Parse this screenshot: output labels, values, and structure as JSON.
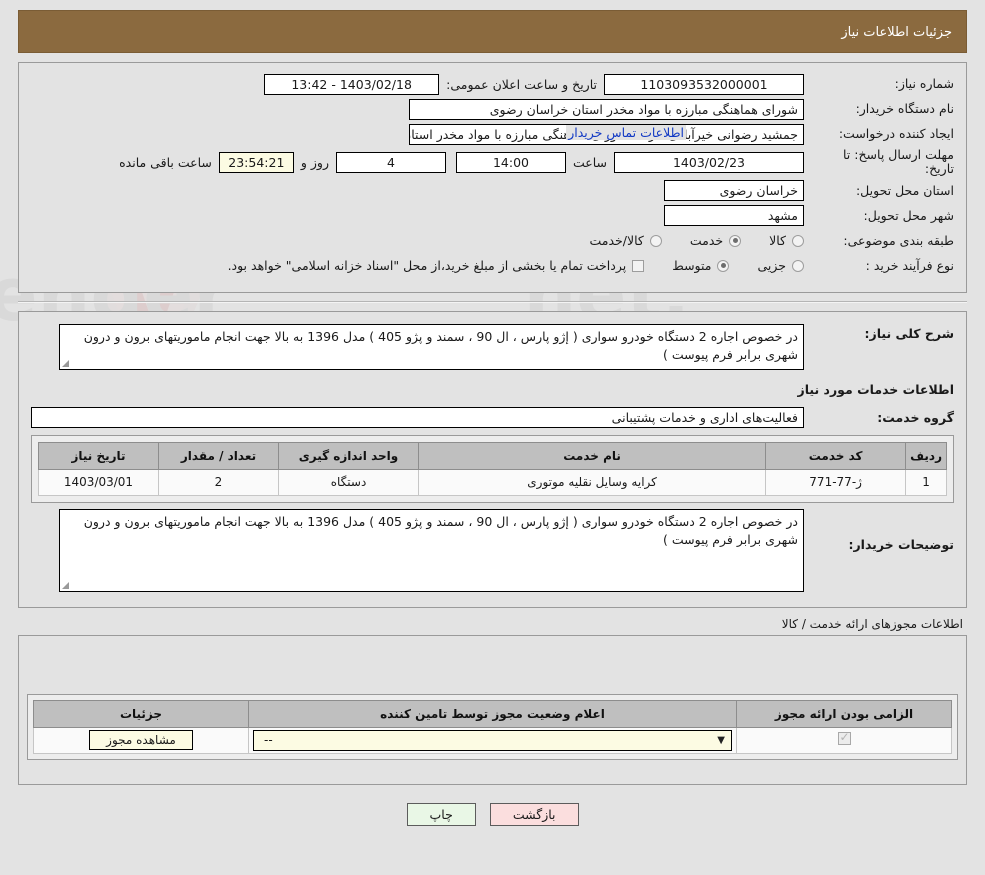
{
  "header": {
    "title": "جزئیات اطلاعات نیاز",
    "bar_color": "#8b6a3f"
  },
  "form": {
    "need_number_label": "شماره نیاز:",
    "need_number_value": "1103093532000001",
    "public_announce_label": "تاریخ و ساعت اعلان عمومی:",
    "public_announce_value": "1403/02/18 - 13:42",
    "buyer_org_label": "نام دستگاه خریدار:",
    "buyer_org_value": "شورای هماهنگی مبارزه با مواد مخدر استان خراسان رضوی",
    "creator_label": "ایجاد کننده درخواست:",
    "creator_value": "جمشید رضوانی خیرآبادی کارمند شورای هماهنگی مبارزه با مواد مخدر استان خ",
    "creator_link": "اطلاعات تماس خریدار",
    "deadline_label": "مهلت ارسال پاسخ: تا تاریخ:",
    "deadline_date": "1403/02/23",
    "deadline_hour_label": "ساعت",
    "deadline_hour": "14:00",
    "remaining_days": "4",
    "remaining_days_label": "روز و",
    "remaining_time": "23:54:21",
    "remaining_suffix": "ساعت باقی مانده",
    "province_label": "استان محل تحویل:",
    "province_value": "خراسان رضوی",
    "city_label": "شهر محل تحویل:",
    "city_value": "مشهد",
    "category_label": "طبقه بندی موضوعی:",
    "category_options": [
      {
        "label": "کالا",
        "selected": false
      },
      {
        "label": "خدمت",
        "selected": true
      },
      {
        "label": "کالا/خدمت",
        "selected": false
      }
    ],
    "process_label": "نوع فرآیند خرید :",
    "process_options": [
      {
        "label": "جزیی",
        "selected": false
      },
      {
        "label": "متوسط",
        "selected": true
      }
    ],
    "treasury_checkbox_checked": false,
    "treasury_note": "پرداخت تمام یا بخشی از مبلغ خرید،از محل \"اسناد خزانه اسلامی\" خواهد بود."
  },
  "description": {
    "label": "شرح کلی نیاز:",
    "value": "در خصوص اجاره 2 دستگاه خودرو سواری ( ﺇژو پارس ، ال 90 ، سمند و پژو 405 ) مدل 1396 به بالا جهت انجام ماموریتهای برون و درون شهری  برابر فرم پیوست )"
  },
  "services_section": {
    "title": "اطلاعات خدمات مورد نیاز",
    "group_label": "گروه خدمت:",
    "group_value": "فعالیت‌های اداری و خدمات پشتیبانی",
    "table": {
      "columns": [
        "ردیف",
        "کد خدمت",
        "نام خدمت",
        "واحد اندازه گیری",
        "تعداد / مقدار",
        "تاریخ نیاز"
      ],
      "rows": [
        [
          "1",
          "ژ-77-771",
          "کرایه وسایل نقلیه موتوری",
          "دستگاه",
          "2",
          "1403/03/01"
        ]
      ]
    }
  },
  "buyer_notes": {
    "label": "توضیحات خریدار:",
    "value": "در خصوص اجاره 2 دستگاه خودرو سواری ( ﺇژو پارس ، ال 90 ، سمند و پژو 405 ) مدل 1396 به بالا جهت انجام ماموریتهای برون و درون شهری  برابر فرم پیوست )"
  },
  "permits": {
    "caption": "اطلاعات مجوزهای ارائه خدمت / کالا",
    "columns": [
      "الزامی بودن ارائه مجوز",
      "اعلام وضعیت مجوز توسط تامین کننده",
      "جزئیات"
    ],
    "row": {
      "required_checked": true,
      "status_value": "--",
      "detail_button": "مشاهده مجوز"
    }
  },
  "footer": {
    "back_label": "بازگشت",
    "print_label": "چاپ",
    "back_color": "#fbdede",
    "print_color": "#e9f7e6"
  }
}
